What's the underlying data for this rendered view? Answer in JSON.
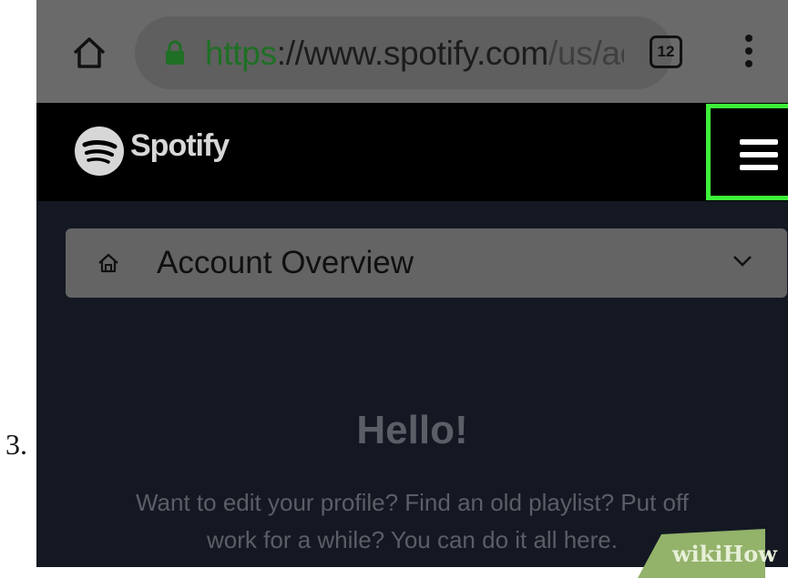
{
  "step_number": "3.",
  "browser": {
    "url_scheme": "https",
    "url_rest": "://www.spotify.com",
    "url_path": "/us/ac",
    "tab_count": "12"
  },
  "header": {
    "brand": "Spotify"
  },
  "account": {
    "label": "Account Overview"
  },
  "hello": {
    "title": "Hello!",
    "line1": "Want to edit your profile? Find an old playlist? Put off",
    "line2": "work for a while? You can do it all here."
  },
  "watermark": {
    "wiki": "wiki",
    "how": "How"
  },
  "colors": {
    "highlight": "#3df23a",
    "lock": "#1f6f25",
    "page_bg": "#131823"
  }
}
